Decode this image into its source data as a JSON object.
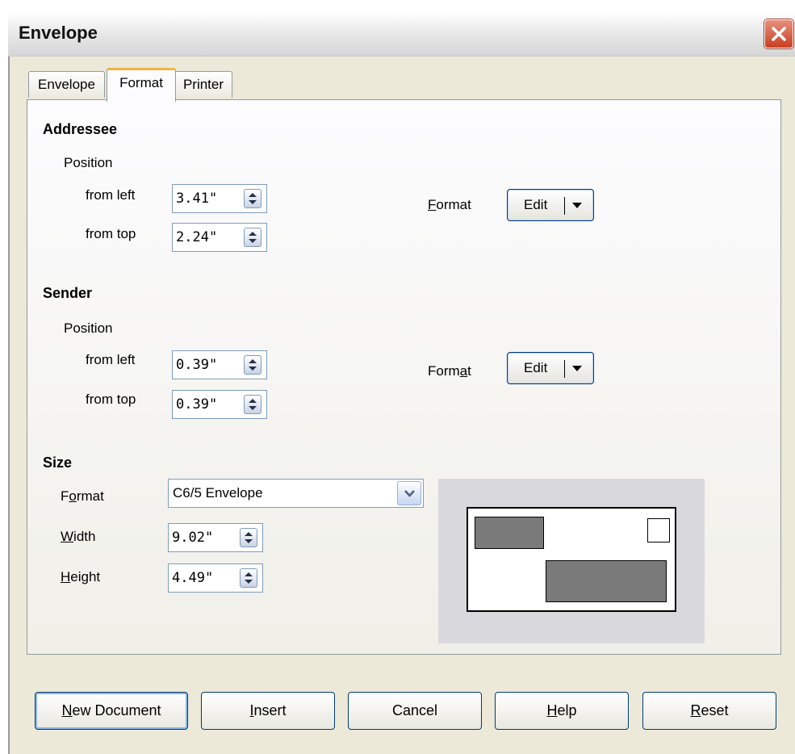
{
  "window": {
    "title": "Envelope"
  },
  "tabs": [
    {
      "label": "Envelope",
      "active": false
    },
    {
      "label": "Format",
      "active": true
    },
    {
      "label": "Printer",
      "active": false
    }
  ],
  "addressee": {
    "heading": "Addressee",
    "position_label": "Position",
    "from_left_label": "from left",
    "from_left_value": "3.41\"",
    "from_top_label": "from top",
    "from_top_value": "2.24\"",
    "format_label_pre": "",
    "format_label_mnemonic": "F",
    "format_label_post": "ormat",
    "edit_label": "Edit"
  },
  "sender": {
    "heading": "Sender",
    "position_label": "Position",
    "from_left_label": "from left",
    "from_left_value": "0.39\"",
    "from_top_label": "from top",
    "from_top_value": "0.39\"",
    "format_label_pre": "Form",
    "format_label_mnemonic": "a",
    "format_label_post": "t",
    "edit_label": "Edit"
  },
  "size": {
    "heading": "Size",
    "format_label_pre": "F",
    "format_label_mnemonic": "o",
    "format_label_post": "rmat",
    "format_value": "C6/5 Envelope",
    "width_label_mnemonic": "W",
    "width_label_post": "idth",
    "width_value": "9.02\"",
    "height_label_mnemonic": "H",
    "height_label_post": "eight",
    "height_value": "4.49\""
  },
  "buttons": {
    "new_document_mnemonic": "N",
    "new_document_post": "ew Document",
    "insert_mnemonic": "I",
    "insert_post": "nsert",
    "cancel": "Cancel",
    "help_mnemonic": "H",
    "help_post": "elp",
    "reset_mnemonic": "R",
    "reset_post": "eset"
  },
  "colors": {
    "dialog_bg": "#ece9d8",
    "active_tab_accent": "#f6b33d",
    "close_button": "#c73f22",
    "button_border": "#003c74"
  },
  "icons": {
    "close": "close-x-icon",
    "spin": "spin-up-down-icon",
    "dropdown": "chevron-down-icon"
  }
}
